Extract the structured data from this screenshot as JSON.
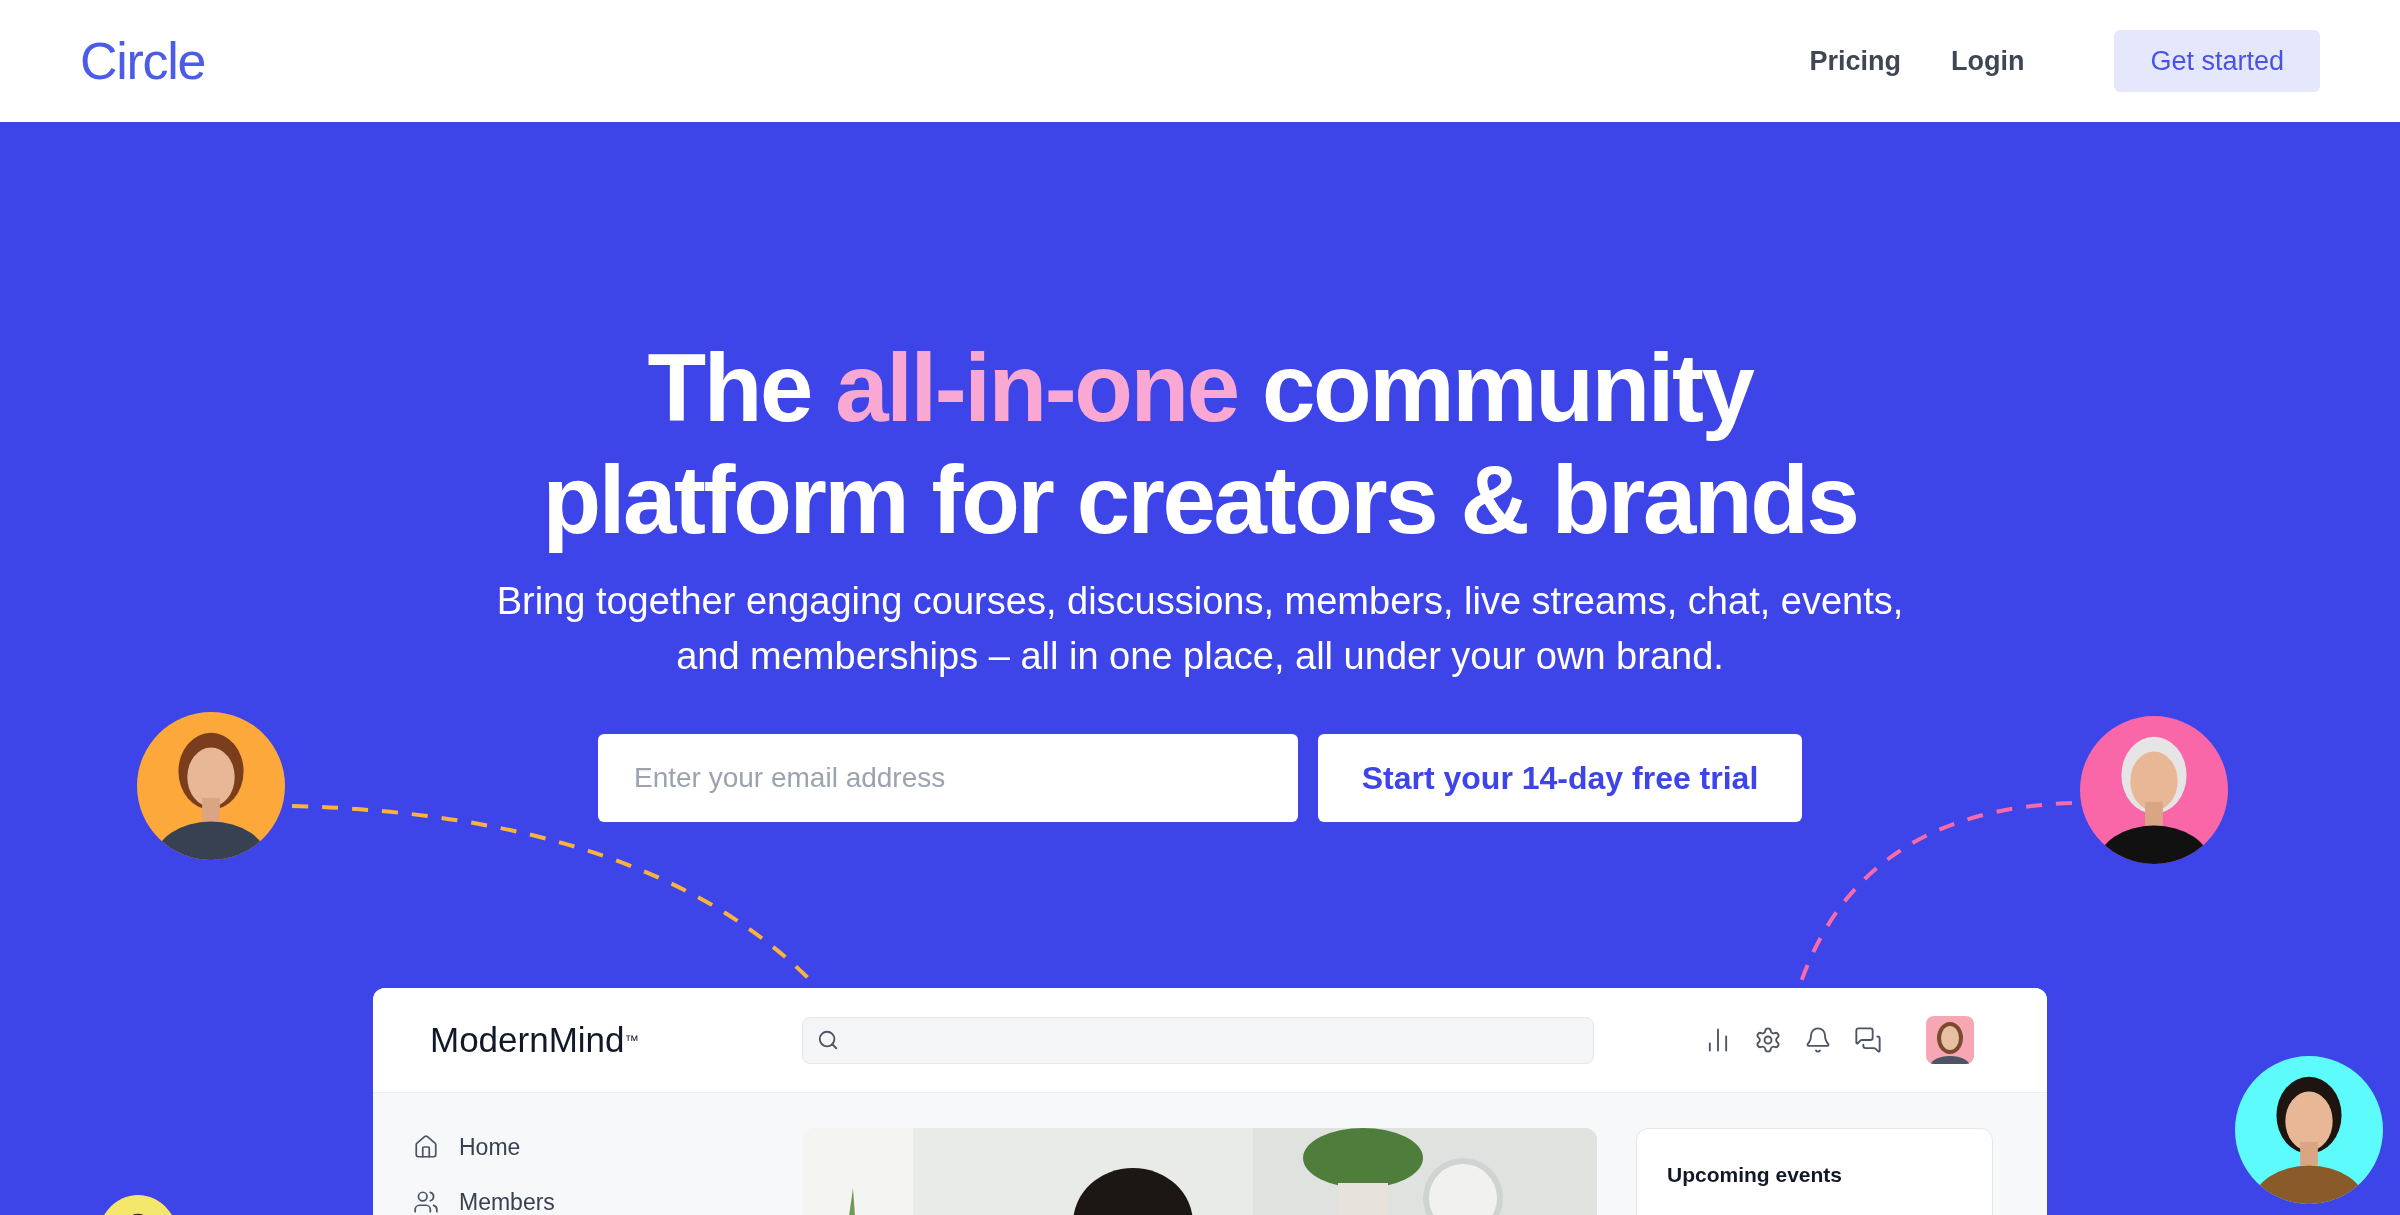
{
  "header": {
    "logo": "Circle",
    "nav": [
      "Pricing",
      "Login"
    ],
    "cta": "Get started"
  },
  "hero": {
    "headline": [
      {
        "text": "The ",
        "highlight": false
      },
      {
        "text": "all-in-one",
        "highlight": true
      },
      {
        "text": " community platform for creators & brands",
        "highlight": false
      }
    ],
    "subtitle": "Bring together engaging courses, discussions, members, live streams, chat, events, and memberships – all in one place, all under your own brand.",
    "email_field": {
      "placeholder": "Enter your email address"
    },
    "cta": "Start your 14-day free trial"
  },
  "app": {
    "brand": "ModernMind",
    "brand_mark": "™",
    "toolbar": [
      {
        "kind": "stats"
      },
      {
        "kind": "settings"
      },
      {
        "kind": "notifications"
      },
      {
        "kind": "messages"
      }
    ],
    "sidebar": [
      {
        "kind": "home",
        "label": "Home"
      },
      {
        "kind": "members",
        "label": "Members"
      }
    ],
    "events_card": {
      "title": "Upcoming events"
    }
  }
}
